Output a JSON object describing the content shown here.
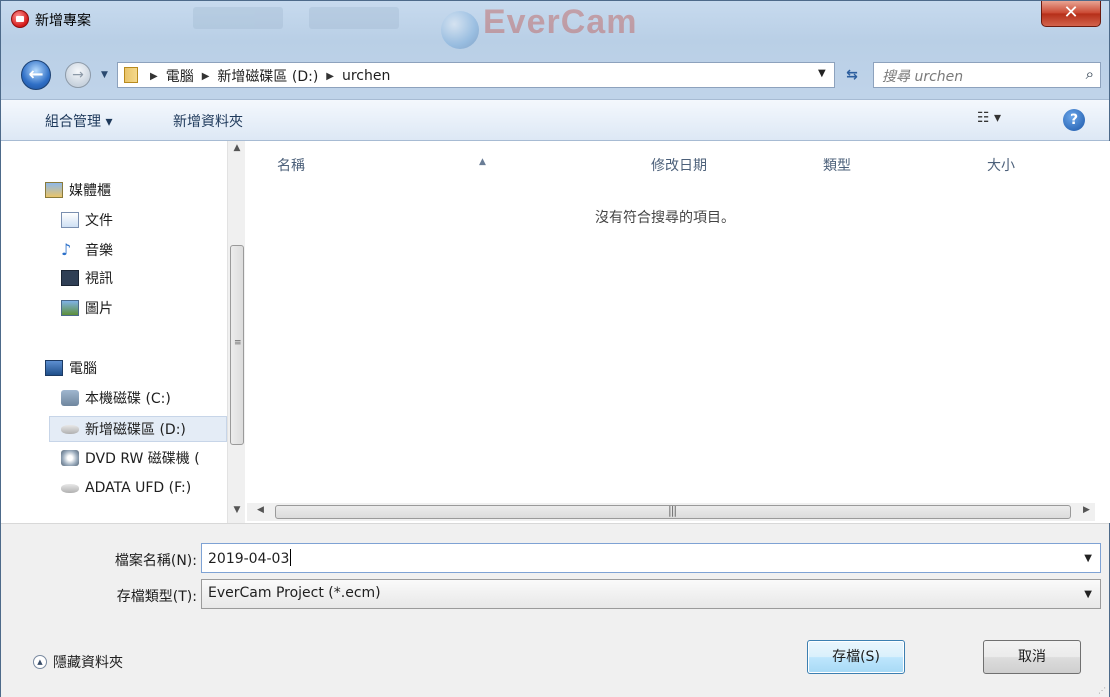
{
  "window": {
    "title": "新增專案"
  },
  "address": {
    "crumbs": [
      "電腦",
      "新增磁碟區 (D:)",
      "urchen"
    ],
    "search_placeholder": "搜尋 urchen"
  },
  "toolbar": {
    "organize": "組合管理 ▾",
    "new_folder": "新增資料夾"
  },
  "nav": {
    "libraries_label": "媒體櫃",
    "libraries": [
      "文件",
      "音樂",
      "視訊",
      "圖片"
    ],
    "computer_label": "電腦",
    "drives": [
      "本機磁碟 (C:)",
      "新增磁碟區 (D:)",
      "DVD RW 磁碟機 (",
      "ADATA UFD (F:)"
    ],
    "selected_drive_index": 1
  },
  "list": {
    "columns": [
      "名稱",
      "修改日期",
      "類型",
      "大小"
    ],
    "empty_message": "沒有符合搜尋的項目。"
  },
  "form": {
    "filename_label": "檔案名稱(N):",
    "filename_value": "2019-04-03",
    "filetype_label": "存檔類型(T):",
    "filetype_value": "EverCam Project (*.ecm)",
    "hide_folders": "隱藏資料夾",
    "save_button": "存檔(S)",
    "cancel_button": "取消"
  },
  "background": {
    "app_logo_text": "EverCam"
  },
  "colors": {
    "close_button": "#c9452f",
    "toolbar_bg": "#dde8f5",
    "selection": "#e4ecf6"
  }
}
